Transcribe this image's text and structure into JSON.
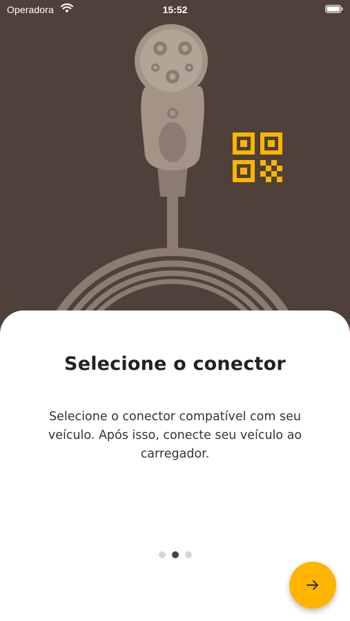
{
  "status_bar": {
    "carrier": "Operadora",
    "time": "15:52",
    "icons": [
      "wifi-icon",
      "battery-icon"
    ]
  },
  "illustration": {
    "subject": "ev-charging-connector-icon",
    "qr": "qr-code-icon"
  },
  "onboarding": {
    "title": "Selecione o conector",
    "description": "Selecione o conector compatível com seu veículo. Após isso, conecte seu veículo ao carregador.",
    "page_index": 2,
    "page_count": 3,
    "next_icon": "arrow-right-icon"
  },
  "colors": {
    "background": "#4f4139",
    "illustration": "#8c7b70",
    "accent": "#ffb400",
    "sheet": "#ffffff",
    "title_text": "#222222",
    "body_text": "#333333",
    "dot_active": "#4f4139",
    "dot_inactive": "#d6d6d6"
  }
}
